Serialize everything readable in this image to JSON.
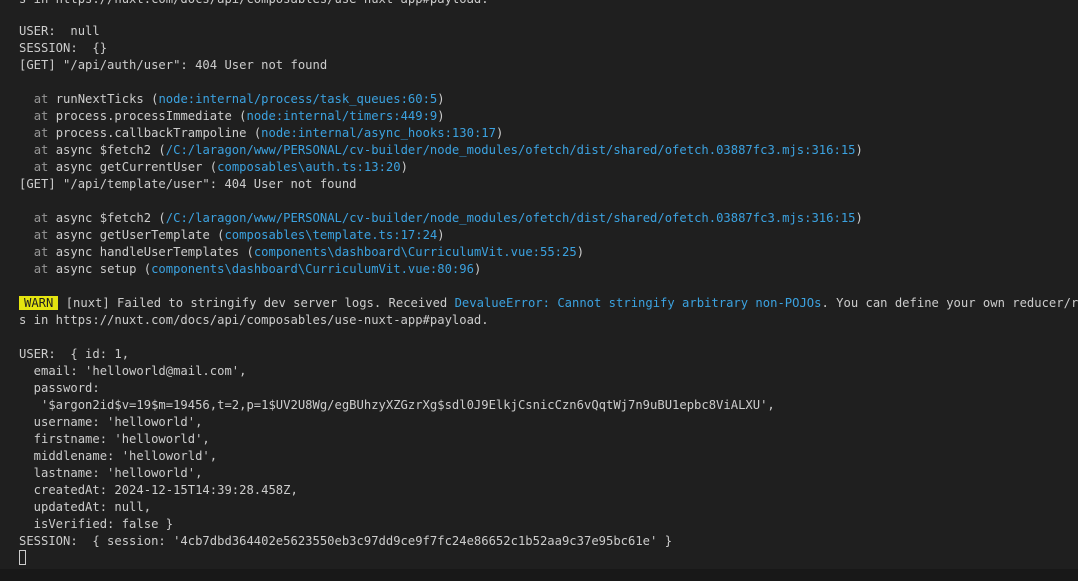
{
  "terminal": {
    "colors": {
      "background": "#1f1f1f",
      "foreground": "#cccccc",
      "link": "#3ba2e0",
      "warn_badge": "#e5e510"
    },
    "top_partial": "s in https://nuxt.com/docs/api/composables/use-nuxt-app#payload.",
    "block1": {
      "user": "USER:  null",
      "session": "SESSION:  {}",
      "err1": "[GET] \"/api/auth/user\": 404 User not found",
      "stack1": [
        {
          "prefix": "at ",
          "fn": "runNextTicks (",
          "loc": "node:internal/process/task_queues:60:5",
          "suffix": ")"
        },
        {
          "prefix": "at ",
          "fn": "process.processImmediate (",
          "loc": "node:internal/timers:449:9",
          "suffix": ")"
        },
        {
          "prefix": "at ",
          "fn": "process.callbackTrampoline (",
          "loc": "node:internal/async_hooks:130:17",
          "suffix": ")"
        },
        {
          "prefix": "at ",
          "fn": "async $fetch2 (",
          "loc": "/C:/laragon/www/PERSONAL/cv-builder/node_modules/ofetch/dist/shared/ofetch.03887fc3.mjs:316:15",
          "suffix": ")"
        },
        {
          "prefix": "at ",
          "fn": "async getCurrentUser (",
          "loc": "composables\\auth.ts:13:20",
          "suffix": ")"
        }
      ],
      "err2": "[GET] \"/api/template/user\": 404 User not found",
      "stack2": [
        {
          "prefix": "at ",
          "fn": "async $fetch2 (",
          "loc": "/C:/laragon/www/PERSONAL/cv-builder/node_modules/ofetch/dist/shared/ofetch.03887fc3.mjs:316:15",
          "suffix": ")"
        },
        {
          "prefix": "at ",
          "fn": "async getUserTemplate (",
          "loc": "composables\\template.ts:17:24",
          "suffix": ")"
        },
        {
          "prefix": "at ",
          "fn": "async handleUserTemplates (",
          "loc": "components\\dashboard\\CurriculumVit.vue:55:25",
          "suffix": ")"
        },
        {
          "prefix": "at ",
          "fn": "async setup (",
          "loc": "components\\dashboard\\CurriculumVit.vue:80:96",
          "suffix": ")"
        }
      ]
    },
    "warn": {
      "badge": "WARN",
      "text1": " [nuxt] Failed to stringify dev server logs. Received ",
      "error": "DevalueError: Cannot stringify arbitrary non-POJOs",
      "text2": ". You can define your own reducer/reviver",
      "wrap": "s in https://nuxt.com/docs/api/composables/use-nuxt-app#payload."
    },
    "block2": {
      "lines": [
        "USER:  { id: 1,",
        "  email: 'helloworld@mail.com',",
        "  password:",
        "   '$argon2id$v=19$m=19456,t=2,p=1$UV2U8Wg/egBUhzyXZGzrXg$sdl0J9ElkjCsnicCzn6vQqtWj7n9uBU1epbc8ViALXU',",
        "  username: 'helloworld',",
        "  firstname: 'helloworld',",
        "  middlename: 'helloworld',",
        "  lastname: 'helloworld',",
        "  createdAt: 2024-12-15T14:39:28.458Z,",
        "  updatedAt: null,",
        "  isVerified: false }",
        "SESSION:  { session: '4cb7dbd364402e5623550eb3c97dd9ce9f7fc24e86652c1b52aa9c37e95bc61e' }"
      ]
    }
  }
}
